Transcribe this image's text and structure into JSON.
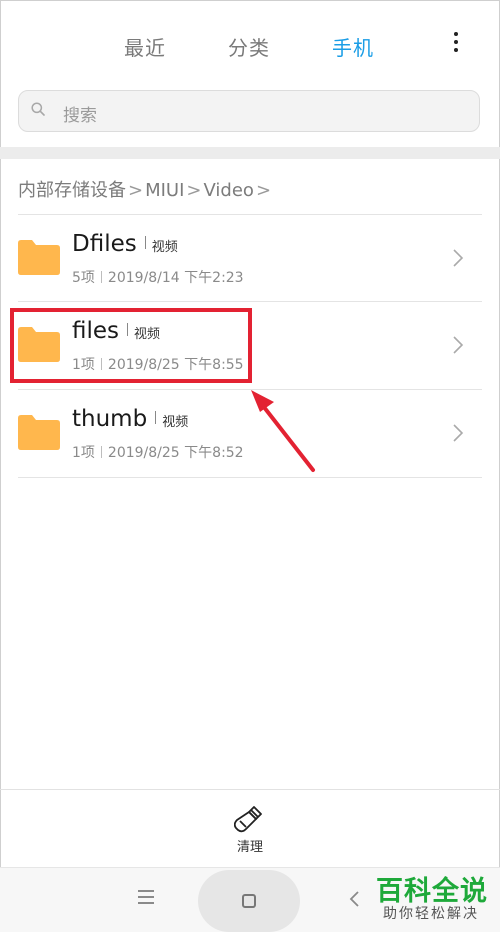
{
  "tabs": [
    {
      "label": "最近",
      "active": false
    },
    {
      "label": "分类",
      "active": false
    },
    {
      "label": "手机",
      "active": true
    }
  ],
  "search": {
    "placeholder": "搜索"
  },
  "breadcrumb": [
    "内部存储设备",
    "MIUI",
    "Video"
  ],
  "files": [
    {
      "name": "Dfiles",
      "tag": "视频",
      "count": "5项",
      "date": "2019/8/14 下午2:23",
      "highlighted": false
    },
    {
      "name": "files",
      "tag": "视频",
      "count": "1项",
      "date": "2019/8/25 下午8:55",
      "highlighted": true
    },
    {
      "name": "thumb",
      "tag": "视频",
      "count": "1项",
      "date": "2019/8/25 下午8:52",
      "highlighted": false
    }
  ],
  "bottom_action": {
    "label": "清理",
    "icon": "broom-icon"
  },
  "watermark": {
    "title": "百科全说",
    "subtitle": "助你轻松解决"
  },
  "colors": {
    "accent": "#1a9de6",
    "folder": "#ffb74d",
    "highlight": "#e32232",
    "watermark": "#1ea93a"
  }
}
